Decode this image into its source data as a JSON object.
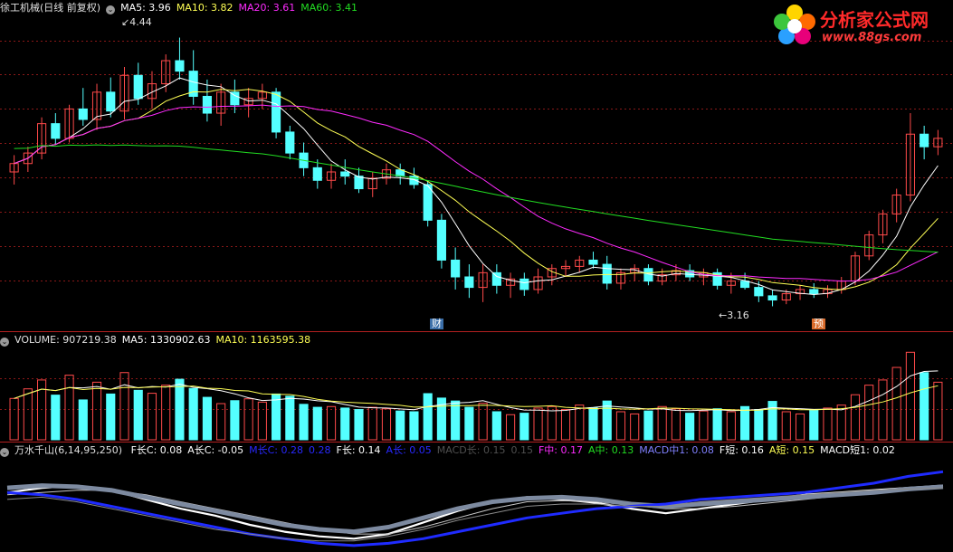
{
  "price_header": {
    "stock": "徐工机械(日线 前复权)",
    "ma5": "MA5: 3.96",
    "ma10": "MA10: 3.82",
    "ma20": "MA20: 3.61",
    "ma60": "MA60: 3.41"
  },
  "volume_header": {
    "volume": "VOLUME: 907219.38",
    "ma5": "MA5: 1330902.63",
    "ma10": "MA10: 1163595.38"
  },
  "indicator_header": {
    "name": "万水千山(6,14,95,250)",
    "items": [
      {
        "label": "F长C: 0.08",
        "color": "#ffffff"
      },
      {
        "label": "A长C: -0.05",
        "color": "#ffffff"
      },
      {
        "label": "M长C: 0.28",
        "color": "#2828ff"
      },
      {
        "label": "0.28",
        "color": "#2828ff"
      },
      {
        "label": "F长: 0.14",
        "color": "#ffffff"
      },
      {
        "label": "A长: 0.05",
        "color": "#2828ff"
      },
      {
        "label": "MACD长: 0.15",
        "color": "#505050"
      },
      {
        "label": "0.15",
        "color": "#505050"
      },
      {
        "label": "F中: 0.17",
        "color": "#ff2bff"
      },
      {
        "label": "A中: 0.13",
        "color": "#22dd22"
      },
      {
        "label": "MACD中1: 0.08",
        "color": "#8080ff"
      },
      {
        "label": "F短: 0.16",
        "color": "#ffffff"
      },
      {
        "label": "A短: 0.15",
        "color": "#ffff55"
      },
      {
        "label": "MACD短1: 0.02",
        "color": "#ffffff"
      }
    ]
  },
  "annotations": {
    "high_label": "4.44",
    "low_label": "3.16",
    "marker_cai": "财",
    "marker_yu": "预"
  },
  "logo": {
    "title": "分析家公式网",
    "url": "www.88gs.com"
  },
  "colors": {
    "up": "#ff4a4a",
    "down": "#54ffff",
    "ma5": "#ffffff",
    "ma10": "#ffff55",
    "ma20": "#ff2bff",
    "ma60": "#22dd22",
    "grid": "#8a1818"
  },
  "chart_data": [
    {
      "type": "candlestick",
      "title": "徐工机械(日线 前复权)",
      "ylim": [
        3.05,
        4.55
      ],
      "candles": [
        {
          "o": 3.8,
          "h": 3.88,
          "l": 3.74,
          "c": 3.84
        },
        {
          "o": 3.84,
          "h": 3.92,
          "l": 3.8,
          "c": 3.89
        },
        {
          "o": 3.89,
          "h": 4.06,
          "l": 3.86,
          "c": 4.03
        },
        {
          "o": 4.03,
          "h": 4.08,
          "l": 3.93,
          "c": 3.96
        },
        {
          "o": 3.96,
          "h": 4.12,
          "l": 3.94,
          "c": 4.1
        },
        {
          "o": 4.1,
          "h": 4.2,
          "l": 4.02,
          "c": 4.05
        },
        {
          "o": 4.05,
          "h": 4.22,
          "l": 4.0,
          "c": 4.18
        },
        {
          "o": 4.18,
          "h": 4.25,
          "l": 4.06,
          "c": 4.09
        },
        {
          "o": 4.09,
          "h": 4.3,
          "l": 4.05,
          "c": 4.26
        },
        {
          "o": 4.26,
          "h": 4.32,
          "l": 4.12,
          "c": 4.15
        },
        {
          "o": 4.15,
          "h": 4.28,
          "l": 4.1,
          "c": 4.22
        },
        {
          "o": 4.22,
          "h": 4.36,
          "l": 4.18,
          "c": 4.33
        },
        {
          "o": 4.33,
          "h": 4.44,
          "l": 4.24,
          "c": 4.28
        },
        {
          "o": 4.28,
          "h": 4.38,
          "l": 4.12,
          "c": 4.16
        },
        {
          "o": 4.16,
          "h": 4.24,
          "l": 4.04,
          "c": 4.08
        },
        {
          "o": 4.08,
          "h": 4.22,
          "l": 4.02,
          "c": 4.18
        },
        {
          "o": 4.18,
          "h": 4.24,
          "l": 4.08,
          "c": 4.12
        },
        {
          "o": 4.12,
          "h": 4.2,
          "l": 4.06,
          "c": 4.15
        },
        {
          "o": 4.15,
          "h": 4.22,
          "l": 4.1,
          "c": 4.18
        },
        {
          "o": 4.18,
          "h": 4.2,
          "l": 3.96,
          "c": 3.99
        },
        {
          "o": 3.99,
          "h": 4.02,
          "l": 3.86,
          "c": 3.89
        },
        {
          "o": 3.89,
          "h": 3.94,
          "l": 3.78,
          "c": 3.82
        },
        {
          "o": 3.82,
          "h": 3.86,
          "l": 3.72,
          "c": 3.76
        },
        {
          "o": 3.76,
          "h": 3.84,
          "l": 3.72,
          "c": 3.8
        },
        {
          "o": 3.8,
          "h": 3.86,
          "l": 3.74,
          "c": 3.78
        },
        {
          "o": 3.78,
          "h": 3.82,
          "l": 3.7,
          "c": 3.72
        },
        {
          "o": 3.72,
          "h": 3.8,
          "l": 3.68,
          "c": 3.77
        },
        {
          "o": 3.77,
          "h": 3.84,
          "l": 3.74,
          "c": 3.81
        },
        {
          "o": 3.81,
          "h": 3.84,
          "l": 3.74,
          "c": 3.78
        },
        {
          "o": 3.78,
          "h": 3.82,
          "l": 3.72,
          "c": 3.74
        },
        {
          "o": 3.74,
          "h": 3.76,
          "l": 3.54,
          "c": 3.57
        },
        {
          "o": 3.57,
          "h": 3.6,
          "l": 3.34,
          "c": 3.38
        },
        {
          "o": 3.38,
          "h": 3.44,
          "l": 3.24,
          "c": 3.3
        },
        {
          "o": 3.3,
          "h": 3.36,
          "l": 3.2,
          "c": 3.25
        },
        {
          "o": 3.25,
          "h": 3.36,
          "l": 3.18,
          "c": 3.32
        },
        {
          "o": 3.32,
          "h": 3.36,
          "l": 3.22,
          "c": 3.26
        },
        {
          "o": 3.26,
          "h": 3.32,
          "l": 3.2,
          "c": 3.29
        },
        {
          "o": 3.29,
          "h": 3.32,
          "l": 3.21,
          "c": 3.24
        },
        {
          "o": 3.24,
          "h": 3.34,
          "l": 3.22,
          "c": 3.3
        },
        {
          "o": 3.3,
          "h": 3.36,
          "l": 3.26,
          "c": 3.34
        },
        {
          "o": 3.34,
          "h": 3.38,
          "l": 3.3,
          "c": 3.35
        },
        {
          "o": 3.35,
          "h": 3.4,
          "l": 3.32,
          "c": 3.38
        },
        {
          "o": 3.38,
          "h": 3.42,
          "l": 3.34,
          "c": 3.36
        },
        {
          "o": 3.36,
          "h": 3.4,
          "l": 3.24,
          "c": 3.27
        },
        {
          "o": 3.27,
          "h": 3.34,
          "l": 3.24,
          "c": 3.32
        },
        {
          "o": 3.32,
          "h": 3.36,
          "l": 3.28,
          "c": 3.34
        },
        {
          "o": 3.34,
          "h": 3.36,
          "l": 3.26,
          "c": 3.28
        },
        {
          "o": 3.28,
          "h": 3.34,
          "l": 3.26,
          "c": 3.31
        },
        {
          "o": 3.31,
          "h": 3.36,
          "l": 3.28,
          "c": 3.33
        },
        {
          "o": 3.33,
          "h": 3.36,
          "l": 3.28,
          "c": 3.3
        },
        {
          "o": 3.3,
          "h": 3.34,
          "l": 3.26,
          "c": 3.32
        },
        {
          "o": 3.32,
          "h": 3.34,
          "l": 3.24,
          "c": 3.26
        },
        {
          "o": 3.26,
          "h": 3.32,
          "l": 3.22,
          "c": 3.28
        },
        {
          "o": 3.28,
          "h": 3.32,
          "l": 3.24,
          "c": 3.25
        },
        {
          "o": 3.25,
          "h": 3.28,
          "l": 3.18,
          "c": 3.21
        },
        {
          "o": 3.21,
          "h": 3.24,
          "l": 3.16,
          "c": 3.19
        },
        {
          "o": 3.19,
          "h": 3.24,
          "l": 3.17,
          "c": 3.22
        },
        {
          "o": 3.22,
          "h": 3.26,
          "l": 3.19,
          "c": 3.24
        },
        {
          "o": 3.24,
          "h": 3.27,
          "l": 3.2,
          "c": 3.22
        },
        {
          "o": 3.22,
          "h": 3.26,
          "l": 3.2,
          "c": 3.24
        },
        {
          "o": 3.24,
          "h": 3.3,
          "l": 3.22,
          "c": 3.28
        },
        {
          "o": 3.28,
          "h": 3.42,
          "l": 3.26,
          "c": 3.4
        },
        {
          "o": 3.4,
          "h": 3.52,
          "l": 3.38,
          "c": 3.5
        },
        {
          "o": 3.5,
          "h": 3.62,
          "l": 3.46,
          "c": 3.6
        },
        {
          "o": 3.6,
          "h": 3.72,
          "l": 3.56,
          "c": 3.69
        },
        {
          "o": 3.69,
          "h": 4.08,
          "l": 3.66,
          "c": 3.98
        },
        {
          "o": 3.98,
          "h": 4.02,
          "l": 3.86,
          "c": 3.92
        },
        {
          "o": 3.92,
          "h": 4.0,
          "l": 3.88,
          "c": 3.96
        }
      ]
    },
    {
      "type": "bar",
      "title": "VOLUME",
      "ylim": [
        0,
        2500000
      ],
      "values": [
        1120000,
        1380000,
        1620000,
        1210000,
        1750000,
        1080000,
        1560000,
        1240000,
        1820000,
        1340000,
        1260000,
        1480000,
        1640000,
        1390000,
        1150000,
        980000,
        1060000,
        1110000,
        1020000,
        1240000,
        1180000,
        960000,
        880000,
        900000,
        860000,
        820000,
        880000,
        840000,
        780000,
        760000,
        1250000,
        1130000,
        1050000,
        880000,
        990000,
        760000,
        680000,
        720000,
        860000,
        900000,
        820000,
        940000,
        870000,
        1050000,
        760000,
        700000,
        780000,
        900000,
        840000,
        720000,
        780000,
        840000,
        760000,
        900000,
        820000,
        1040000,
        760000,
        700000,
        800000,
        860000,
        940000,
        1220000,
        1480000,
        1620000,
        1960000,
        2370000,
        1820000,
        1560000
      ]
    },
    {
      "type": "line",
      "title": "万水千山(6,14,95,250)",
      "ylim": [
        -0.4,
        0.4
      ],
      "series": [
        {
          "name": "F短",
          "values": [
            0.1,
            0.14,
            0.16,
            0.12,
            0.04,
            -0.04,
            -0.1,
            -0.18,
            -0.24,
            -0.28,
            -0.3,
            -0.26,
            -0.16,
            -0.06,
            0.02,
            0.06,
            0.04,
            0.01,
            -0.04,
            -0.08,
            -0.04,
            0.0,
            0.04,
            0.08,
            0.1,
            0.12,
            0.14,
            0.16
          ]
        },
        {
          "name": "A短",
          "values": [
            0.08,
            0.1,
            0.12,
            0.12,
            0.08,
            0.02,
            -0.04,
            -0.1,
            -0.16,
            -0.22,
            -0.26,
            -0.26,
            -0.2,
            -0.12,
            -0.04,
            0.02,
            0.03,
            0.02,
            -0.01,
            -0.04,
            -0.04,
            -0.02,
            0.01,
            0.04,
            0.07,
            0.09,
            0.12,
            0.15
          ]
        },
        {
          "name": "MACD长",
          "values": [
            0.14,
            0.16,
            0.15,
            0.12,
            0.06,
            0.0,
            -0.06,
            -0.12,
            -0.18,
            -0.22,
            -0.24,
            -0.2,
            -0.12,
            -0.04,
            0.02,
            0.05,
            0.06,
            0.04,
            0.0,
            -0.02,
            0.0,
            0.02,
            0.04,
            0.06,
            0.08,
            0.1,
            0.13,
            0.15
          ]
        },
        {
          "name": "M长C",
          "values": [
            0.1,
            0.08,
            0.04,
            -0.02,
            -0.08,
            -0.14,
            -0.2,
            -0.26,
            -0.3,
            -0.34,
            -0.36,
            -0.34,
            -0.3,
            -0.24,
            -0.18,
            -0.12,
            -0.08,
            -0.04,
            -0.02,
            0.0,
            0.04,
            0.06,
            0.08,
            0.1,
            0.14,
            0.18,
            0.24,
            0.28
          ]
        },
        {
          "name": "F长",
          "values": [
            0.04,
            0.06,
            0.02,
            -0.04,
            -0.1,
            -0.16,
            -0.22,
            -0.26,
            -0.3,
            -0.32,
            -0.32,
            -0.28,
            -0.22,
            -0.14,
            -0.08,
            -0.02,
            0.0,
            0.0,
            -0.02,
            -0.02,
            0.02,
            0.04,
            0.06,
            0.08,
            0.1,
            0.12,
            0.13,
            0.14
          ]
        }
      ]
    }
  ]
}
